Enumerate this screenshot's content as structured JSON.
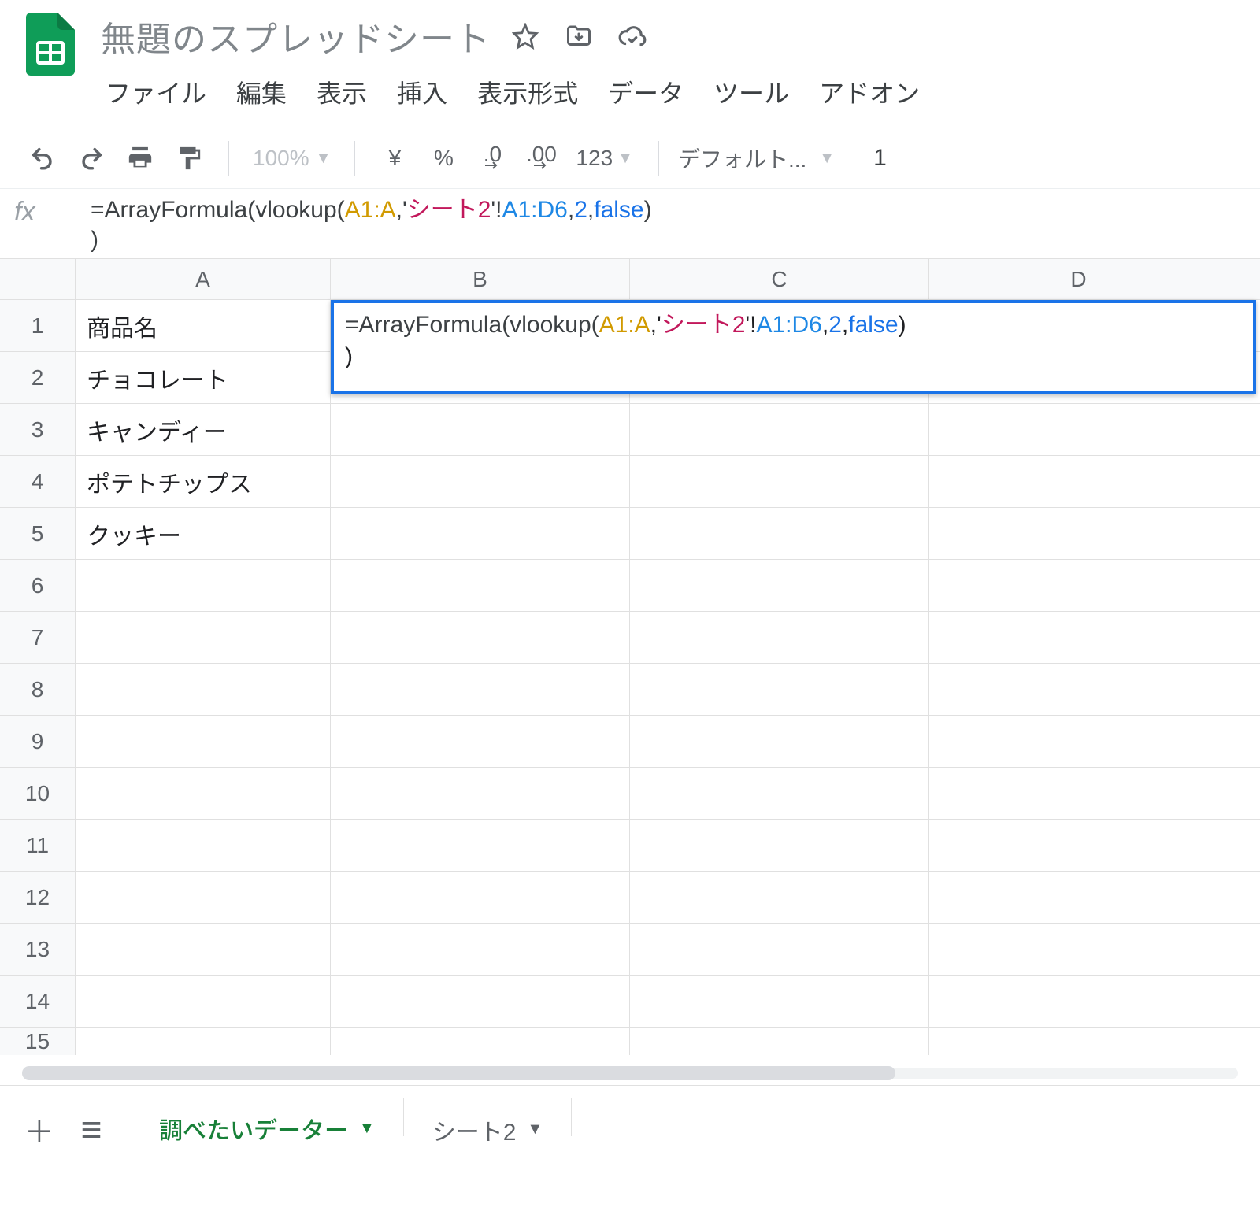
{
  "header": {
    "title": "無題のスプレッドシート",
    "menus": [
      "ファイル",
      "編集",
      "表示",
      "挿入",
      "表示形式",
      "データ",
      "ツール",
      "アドオン"
    ]
  },
  "toolbar": {
    "zoom": "100%",
    "currency": "¥",
    "percent": "%",
    "dec_less": ".0",
    "dec_more": ".00",
    "number_format": "123",
    "font": "デフォルト...",
    "font_size": "1"
  },
  "formula_bar": {
    "label": "fx",
    "parts": {
      "p1": "=ArrayFormula(",
      "p2": "vlookup(",
      "range": "A1:A",
      "c1": ",'",
      "sheet": "シート2",
      "c2": "'!",
      "ref": "A1:D6",
      "c3": ",",
      "num": "2",
      "c4": ",",
      "kw": "false",
      "c5": ")",
      "tail": ")"
    }
  },
  "grid": {
    "columns": [
      "A",
      "B",
      "C",
      "D"
    ],
    "rows": [
      {
        "n": "1",
        "A": "商品名"
      },
      {
        "n": "2",
        "A": "チョコレート"
      },
      {
        "n": "3",
        "A": "キャンディー"
      },
      {
        "n": "4",
        "A": "ポテトチップス"
      },
      {
        "n": "5",
        "A": "クッキー"
      },
      {
        "n": "6",
        "A": ""
      },
      {
        "n": "7",
        "A": ""
      },
      {
        "n": "8",
        "A": ""
      },
      {
        "n": "9",
        "A": ""
      },
      {
        "n": "10",
        "A": ""
      },
      {
        "n": "11",
        "A": ""
      },
      {
        "n": "12",
        "A": ""
      },
      {
        "n": "13",
        "A": ""
      },
      {
        "n": "14",
        "A": ""
      },
      {
        "n": "15",
        "A": ""
      }
    ]
  },
  "tabs": {
    "active": "調べたいデーター",
    "other": "シート2"
  }
}
